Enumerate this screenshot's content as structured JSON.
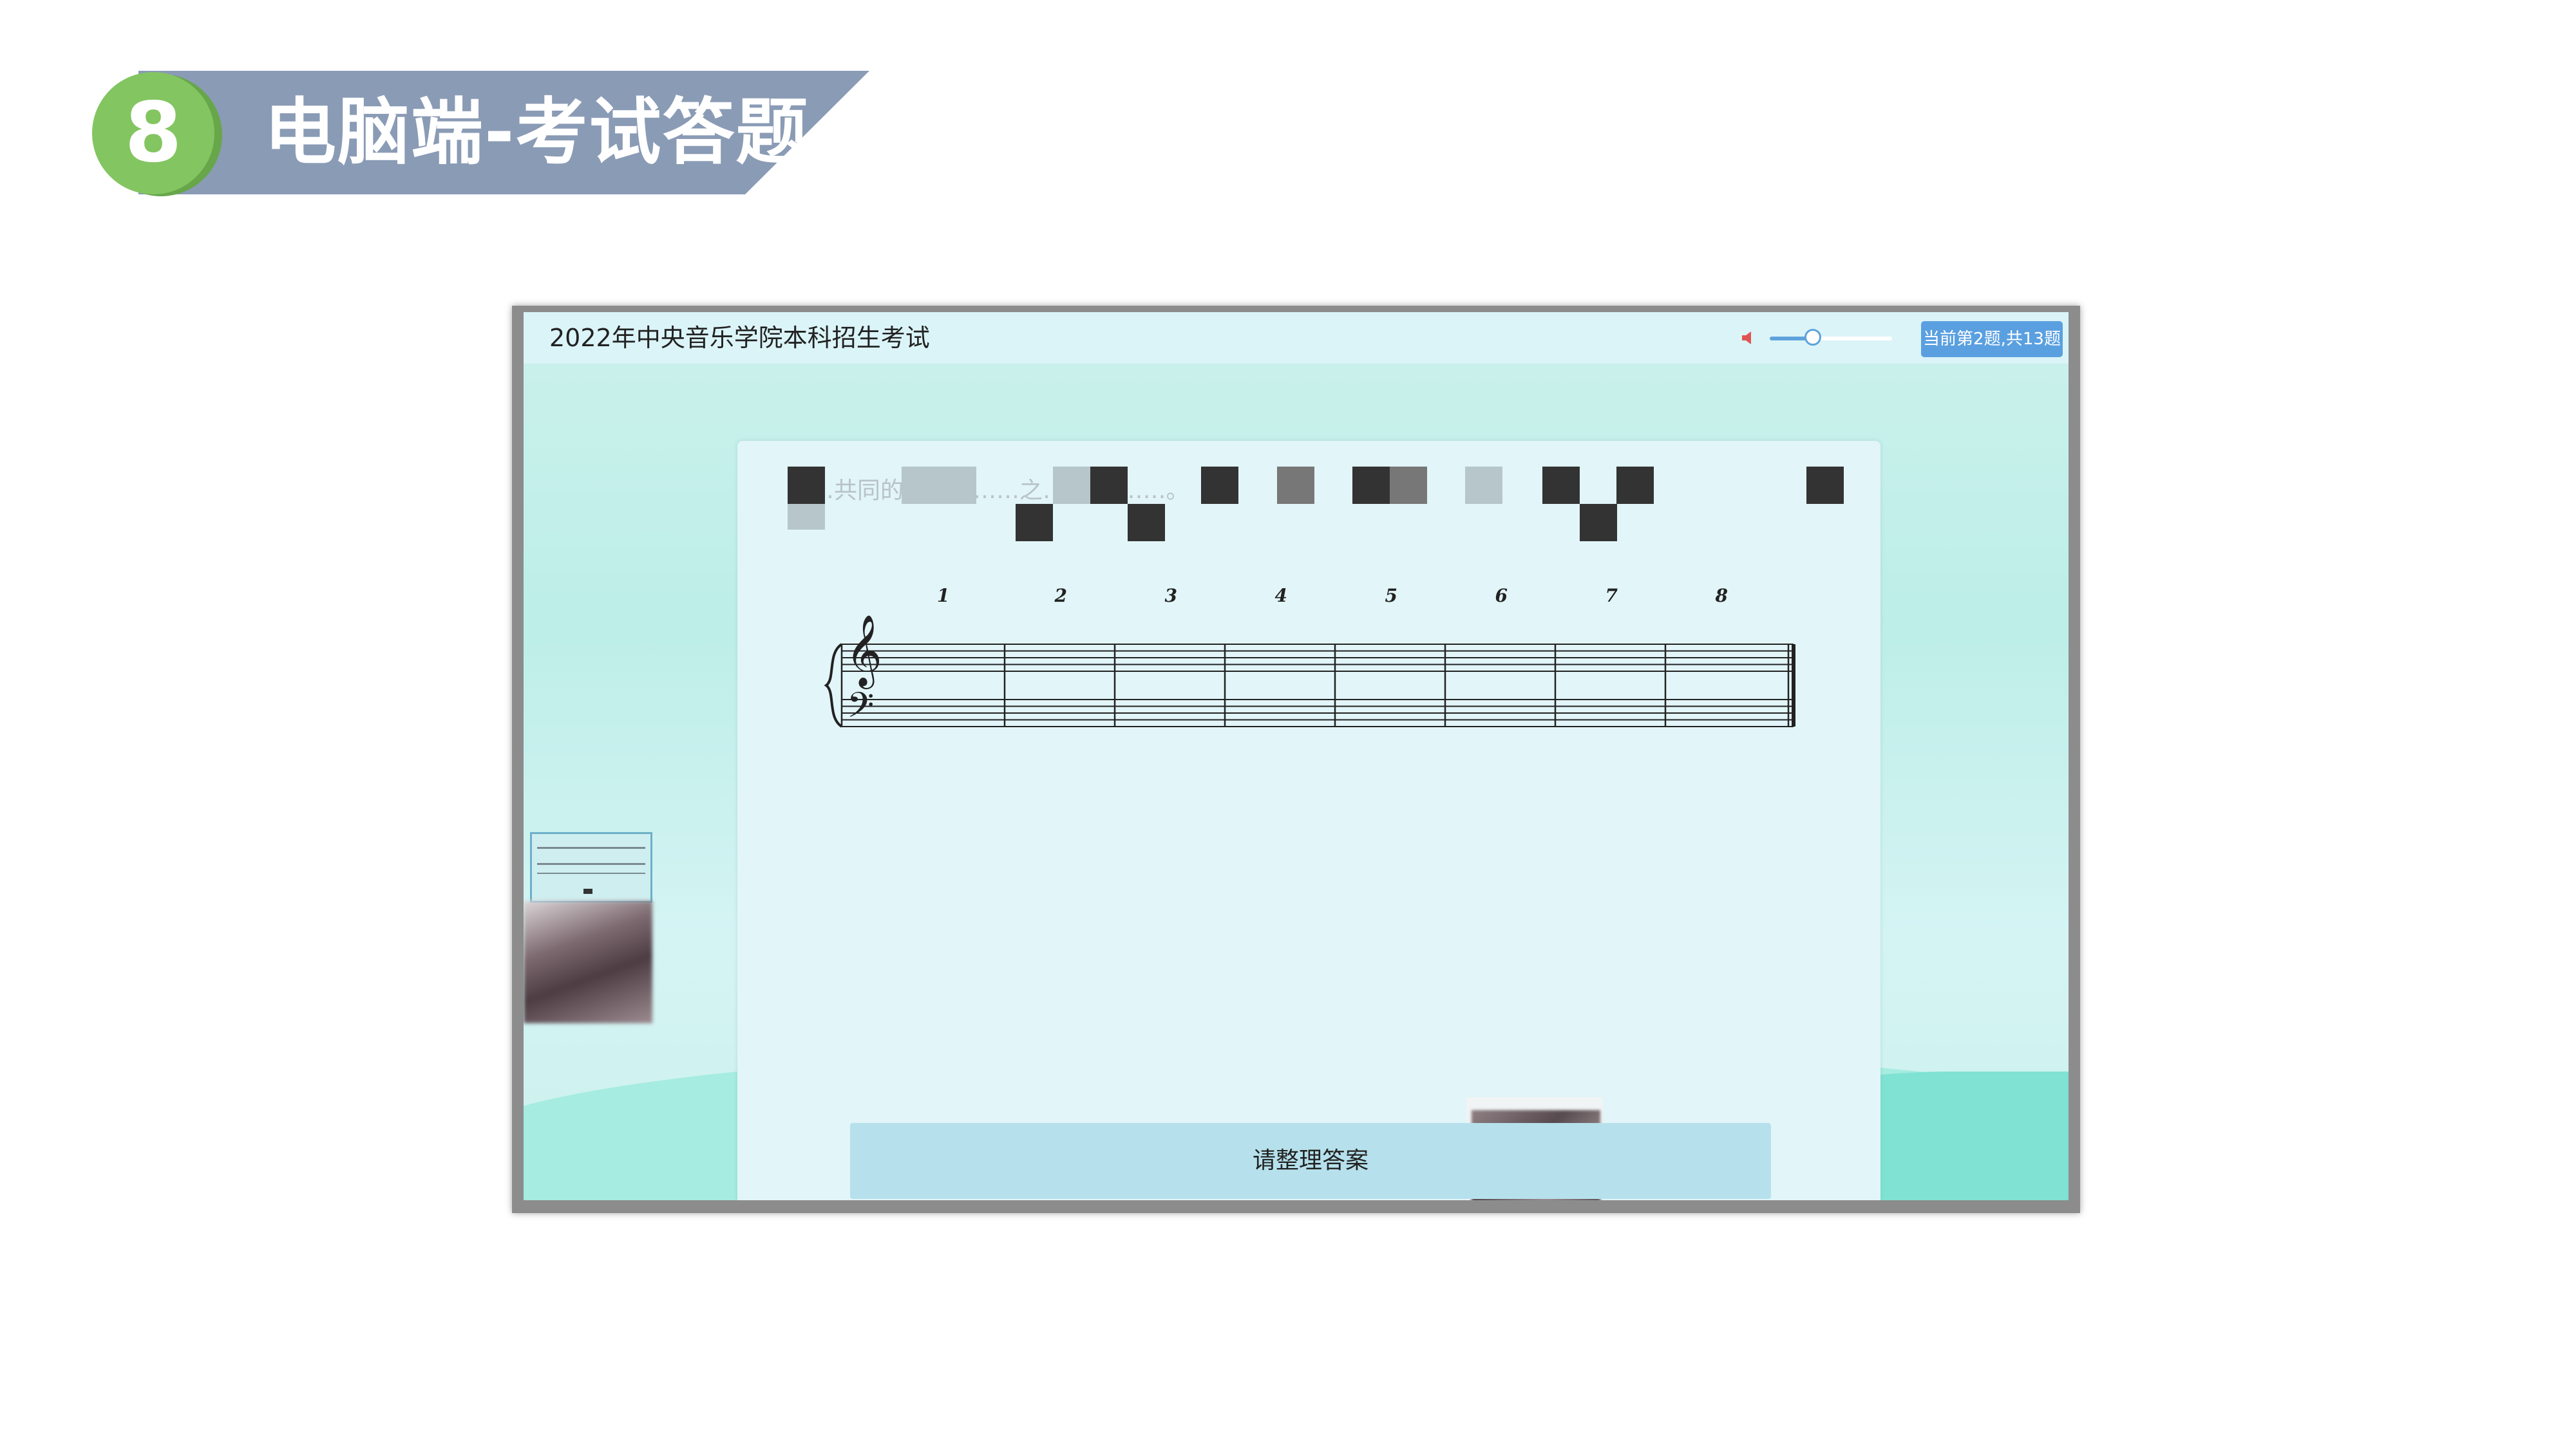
{
  "slide": {
    "section_number": "8",
    "section_title": "电脑端-考试答题"
  },
  "exam": {
    "title": "2022年中央音乐学院本科招生考试",
    "volume_level": 0.35,
    "progress_badge": "当前第2题,共13题",
    "question_text_fragments": "……共同的……每……之……能,……。",
    "measure_numbers": [
      "1",
      "2",
      "3",
      "4",
      "5",
      "6",
      "7",
      "8"
    ],
    "answer_button_label": "请整理答案"
  },
  "colors": {
    "header_band": "#8a9bb5",
    "badge_green": "#83c561",
    "progress_badge_blue": "#5aa0e0",
    "answer_button": "#b6e1ec"
  }
}
